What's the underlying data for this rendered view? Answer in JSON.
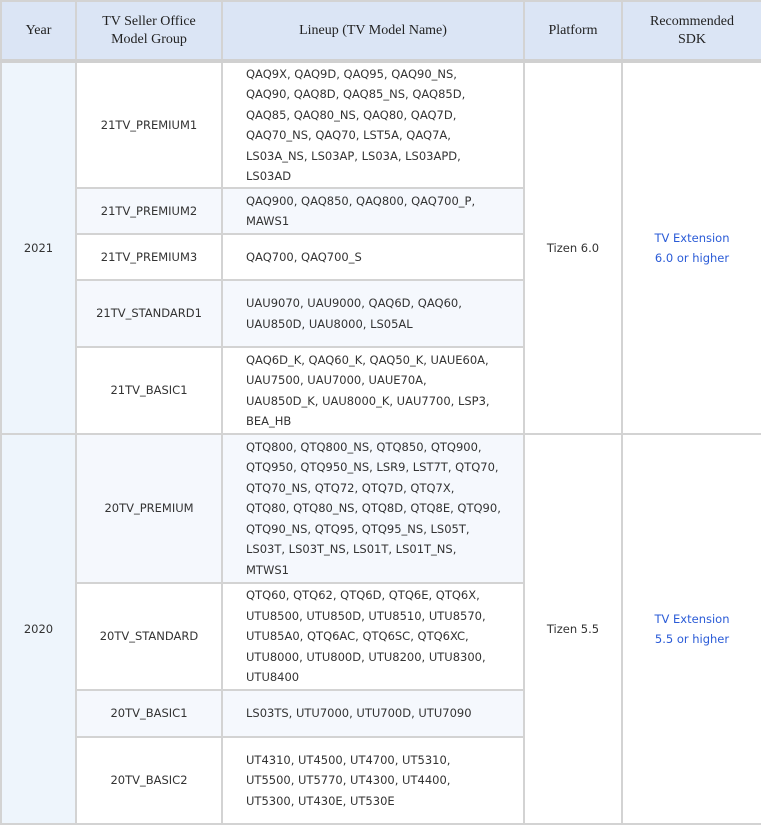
{
  "headers": {
    "year": "Year",
    "group": "TV Seller Office Model Group",
    "lineup": "Lineup (TV Model Name)",
    "platform": "Platform",
    "sdk": "Recommended SDK"
  },
  "years": [
    {
      "year": "2021",
      "platform": "Tizen 6.0",
      "sdk": "TV Extension 6.0 or higher",
      "rows": [
        {
          "group": "21TV_PREMIUM1",
          "lineup": "QAQ9X, QAQ9D, QAQ95, QAQ90_NS, QAQ90, QAQ8D, QAQ85_NS, QAQ85D, QAQ85, QAQ80_NS, QAQ80, QAQ7D, QAQ70_NS, QAQ70, LST5A, QAQ7A, LS03A_NS, LS03AP, LS03A, LS03APD, LS03AD"
        },
        {
          "group": "21TV_PREMIUM2",
          "lineup": "QAQ900, QAQ850, QAQ800, QAQ700_P, MAWS1"
        },
        {
          "group": "21TV_PREMIUM3",
          "lineup": "QAQ700, QAQ700_S"
        },
        {
          "group": "21TV_STANDARD1",
          "lineup": "UAU9070, UAU9000, QAQ6D, QAQ60, UAU850D, UAU8000, LS05AL"
        },
        {
          "group": "21TV_BASIC1",
          "lineup": "QAQ6D_K, QAQ60_K, QAQ50_K, UAUE60A, UAU7500, UAU7000, UAUE70A, UAU850D_K, UAU8000_K, UAU7700, LSP3, BEA_HB"
        }
      ]
    },
    {
      "year": "2020",
      "platform": "Tizen 5.5",
      "sdk": "TV Extension 5.5 or higher",
      "rows": [
        {
          "group": "20TV_PREMIUM",
          "lineup": "QTQ800, QTQ800_NS, QTQ850, QTQ900, QTQ950, QTQ950_NS, LSR9, LST7T, QTQ70, QTQ70_NS, QTQ72, QTQ7D, QTQ7X, QTQ80, QTQ80_NS, QTQ8D, QTQ8E, QTQ90, QTQ90_NS, QTQ95, QTQ95_NS, LS05T, LS03T, LS03T_NS, LS01T, LS01T_NS, MTWS1"
        },
        {
          "group": "20TV_STANDARD",
          "lineup": "QTQ60, QTQ62, QTQ6D, QTQ6E, QTQ6X, UTU8500, UTU850D, UTU8510, UTU8570, UTU85A0, QTQ6AC, QTQ6SC, QTQ6XC, UTU8000, UTU800D, UTU8200, UTU8300, UTU8400"
        },
        {
          "group": "20TV_BASIC1",
          "lineup": "LS03TS, UTU7000, UTU700D, UTU7090"
        },
        {
          "group": "20TV_BASIC2",
          "lineup": "UT4310, UT4500, UT4700, UT5310, UT5500, UT5770, UT4300, UT4400, UT5300, UT430E, UT530E"
        }
      ]
    }
  ]
}
